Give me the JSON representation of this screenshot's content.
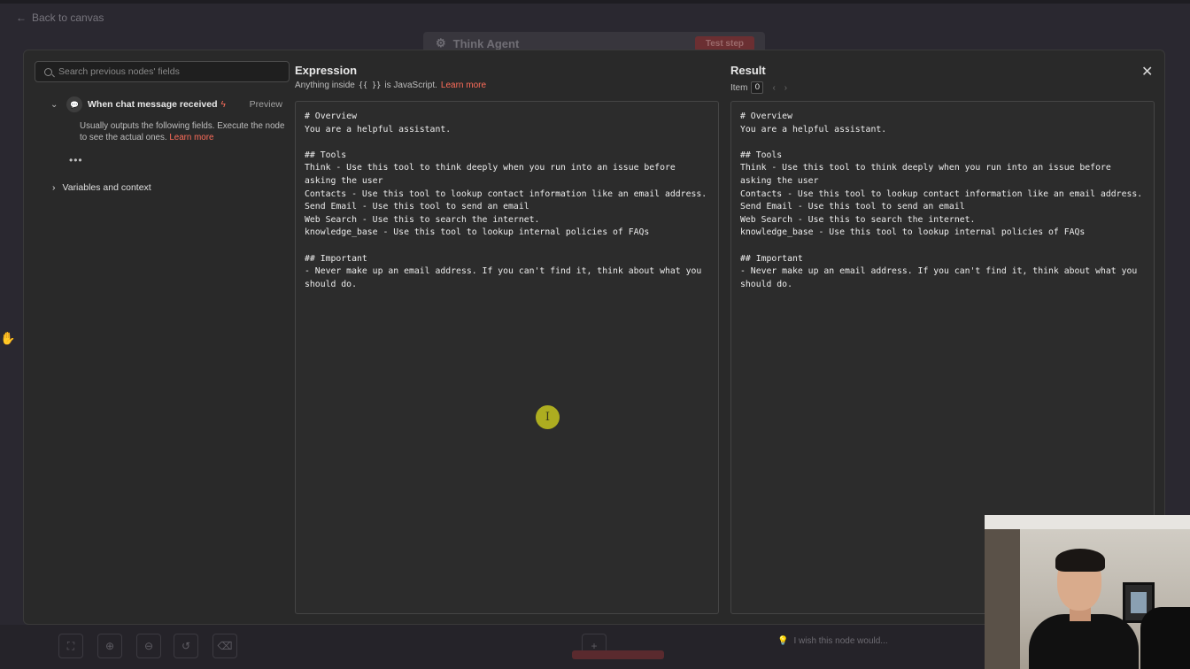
{
  "background": {
    "back_link": "Back to canvas",
    "node_title": "Think Agent",
    "test_step": "Test step",
    "wish_text": "I wish this node would..."
  },
  "left_panel": {
    "search_placeholder": "Search previous nodes' fields",
    "trigger": {
      "name": "When chat message received",
      "preview": "Preview",
      "hint": "Usually outputs the following fields. Execute the node to see the actual ones.",
      "hint_link": "Learn more",
      "more": "•••"
    },
    "variables": "Variables and context"
  },
  "expression": {
    "title": "Expression",
    "sub_prefix": "Anything inside",
    "sub_braces": "{{ }}",
    "sub_suffix": "is JavaScript.",
    "sub_link": "Learn more",
    "code": "# Overview\nYou are a helpful assistant.\n\n## Tools\nThink - Use this tool to think deeply when you run into an issue before asking the user\nContacts - Use this tool to lookup contact information like an email address.\nSend Email - Use this tool to send an email\nWeb Search - Use this to search the internet.\nknowledge_base - Use this tool to lookup internal policies of FAQs\n\n## Important\n- Never make up an email address. If you can't find it, think about what you should do."
  },
  "result": {
    "title": "Result",
    "item_label": "Item",
    "item_index": "0",
    "code": "# Overview\nYou are a helpful assistant.\n\n## Tools\nThink - Use this tool to think deeply when you run into an issue before asking the user\nContacts - Use this tool to lookup contact information like an email address.\nSend Email - Use this tool to send an email\nWeb Search - Use this to search the internet.\nknowledge_base - Use this tool to lookup internal policies of FAQs\n\n## Important\n- Never make up an email address. If you can't find it, think about what you should do."
  },
  "icons": {
    "close": "close-icon",
    "search": "search-icon",
    "chat": "chat-icon",
    "bolt": "bolt-icon"
  },
  "colors": {
    "accent": "#ff6d5a",
    "modal_bg": "#292929",
    "cursor_highlight": "#b8b91f"
  }
}
